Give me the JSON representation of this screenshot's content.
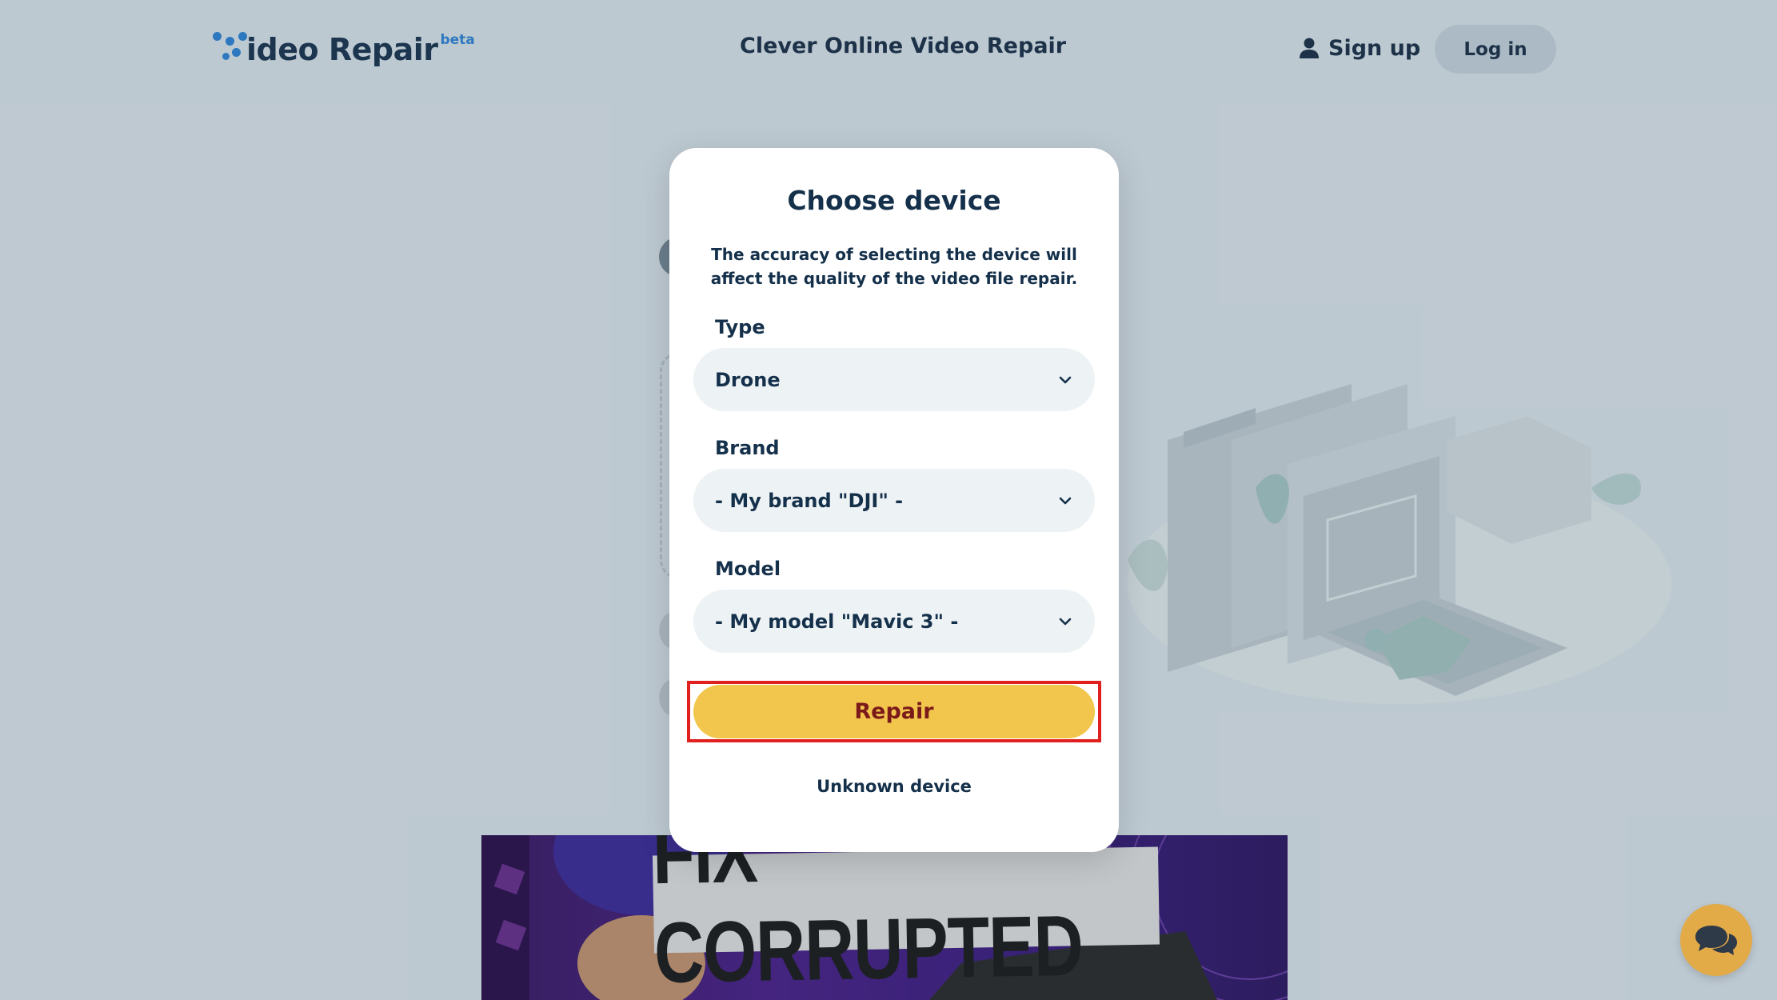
{
  "header": {
    "logo_text": "ideo Repair",
    "logo_beta": "beta",
    "title": "Clever Online Video Repair",
    "signup_label": "Sign up",
    "login_label": "Log in"
  },
  "modal": {
    "title": "Choose device",
    "description": "The accuracy of selecting the device will affect the quality of the video file repair.",
    "type_label": "Type",
    "type_value": "Drone",
    "brand_label": "Brand",
    "brand_value": "- My brand \"DJI\" -",
    "model_label": "Model",
    "model_value": "- My model \"Mavic 3\" -",
    "repair_label": "Repair",
    "unknown_label": "Unknown device"
  },
  "video": {
    "banner_text": "FIX CORRUPTED"
  },
  "colors": {
    "accent_blue": "#2f86d8",
    "repair_yellow": "#f2c64c",
    "highlight_red": "#e01f1f",
    "chat_orange": "#e3aa48"
  },
  "icons": [
    "user-icon",
    "chevron-down-icon",
    "chat-icon"
  ]
}
